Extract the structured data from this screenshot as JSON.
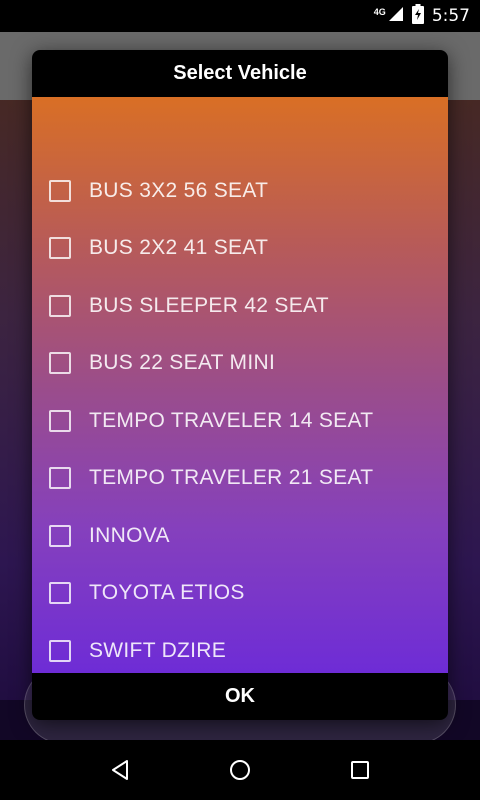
{
  "status_bar": {
    "network": "4G",
    "time": "5:57"
  },
  "dialog": {
    "title": "Select Vehicle",
    "options": [
      {
        "label": "BUS 3X2 56 SEAT",
        "checked": false
      },
      {
        "label": "BUS 2X2 41 SEAT",
        "checked": false
      },
      {
        "label": "BUS SLEEPER 42 SEAT",
        "checked": false
      },
      {
        "label": "BUS 22 SEAT MINI",
        "checked": false
      },
      {
        "label": "TEMPO TRAVELER 14 SEAT",
        "checked": false
      },
      {
        "label": "TEMPO TRAVELER 21 SEAT",
        "checked": false
      },
      {
        "label": "INNOVA",
        "checked": false
      },
      {
        "label": "TOYOTA ETIOS",
        "checked": false
      },
      {
        "label": "SWIFT DZIRE",
        "checked": false
      }
    ],
    "ok_label": "OK"
  },
  "nav_bar": {
    "back_icon": "back-triangle-icon",
    "home_icon": "home-circle-icon",
    "recents_icon": "recents-square-icon"
  }
}
